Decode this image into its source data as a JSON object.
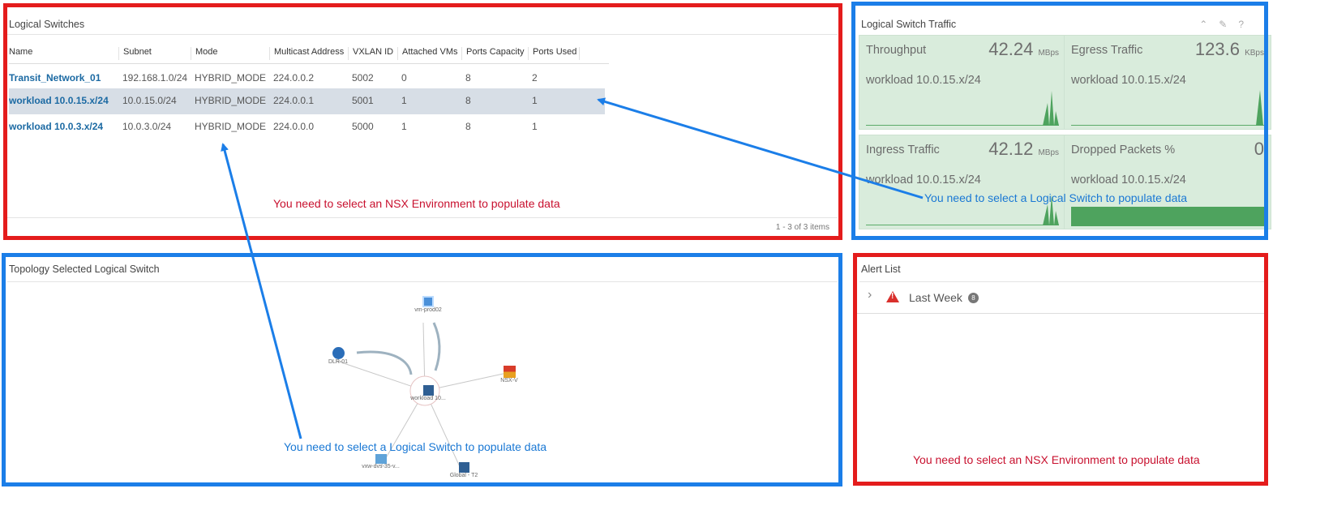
{
  "logical_switches": {
    "title": "Logical Switches",
    "columns": [
      "Name",
      "Subnet",
      "Mode",
      "Multicast Address",
      "VXLAN ID",
      "Attached VMs",
      "Ports Capacity",
      "Ports Used"
    ],
    "rows": [
      {
        "name": "Transit_Network_01",
        "subnet": "192.168.1.0/24",
        "mode": "HYBRID_MODE",
        "multicast": "224.0.0.2",
        "vxlan": "5002",
        "vms": "0",
        "capacity": "8",
        "used": "2"
      },
      {
        "name": "workload 10.0.15.x/24",
        "subnet": "10.0.15.0/24",
        "mode": "HYBRID_MODE",
        "multicast": "224.0.0.1",
        "vxlan": "5001",
        "vms": "1",
        "capacity": "8",
        "used": "1"
      },
      {
        "name": "workload 10.0.3.x/24",
        "subnet": "10.0.3.0/24",
        "mode": "HYBRID_MODE",
        "multicast": "224.0.0.0",
        "vxlan": "5000",
        "vms": "1",
        "capacity": "8",
        "used": "1"
      }
    ],
    "message": "You need to select an NSX Environment to populate data",
    "footer": "1 - 3 of 3 items"
  },
  "traffic": {
    "title": "Logical Switch Traffic",
    "header_icons": [
      "collapse-icon",
      "edit-icon",
      "help-icon"
    ],
    "header_glyphs": {
      "collapse": "⌃",
      "edit": "✎",
      "help": "?"
    },
    "tiles": [
      {
        "label": "Throughput",
        "value": "42.24",
        "unit": "MBps",
        "sub": "workload 10.0.15.x/24"
      },
      {
        "label": "Egress Traffic",
        "value": "123.6",
        "unit": "KBps",
        "sub": "workload 10.0.15.x/24"
      },
      {
        "label": "Ingress Traffic",
        "value": "42.12",
        "unit": "MBps",
        "sub": "workload 10.0.15.x/24"
      },
      {
        "label": "Dropped Packets %",
        "value": "0",
        "unit": "",
        "sub": "workload 10.0.15.x/24"
      }
    ],
    "message": "You need to select a Logical Switch to populate data"
  },
  "topology": {
    "title": "Topology Selected Logical Switch",
    "nodes": {
      "center": "workload 10...",
      "vm": "vm-prod02",
      "dlr": "DLR-01",
      "nsx": "NSX-V",
      "vxw": "vxw-dvs-35-v...",
      "global": "Global - T2"
    },
    "message": "You need to select a Logical Switch to populate data"
  },
  "alerts": {
    "title": "Alert List",
    "group_label": "Last Week",
    "group_count": "8",
    "chevron_glyph": "›",
    "warning_glyph": "!",
    "message": "You need to select an NSX Environment to populate data"
  },
  "colors": {
    "red_outline": "#e41c1c",
    "blue_outline": "#1b7ee8",
    "tile_bg": "#d9ecdc",
    "spark": "#4ea35e"
  }
}
